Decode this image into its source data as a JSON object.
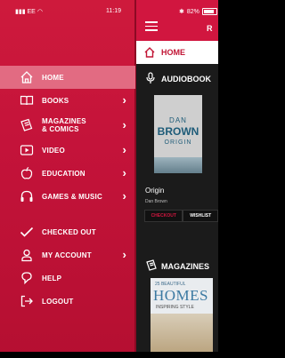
{
  "status_bar": {
    "carrier": "EE",
    "time": "11:19",
    "battery": "82%"
  },
  "menu": {
    "items": [
      {
        "label": "HOME",
        "icon": "home-icon"
      },
      {
        "label": "BOOKS",
        "icon": "book-icon"
      },
      {
        "label_line1": "MAGAZINES",
        "label_line2": "& COMICS",
        "icon": "magazine-icon"
      },
      {
        "label": "VIDEO",
        "icon": "video-icon"
      },
      {
        "label": "EDUCATION",
        "icon": "apple-icon"
      },
      {
        "label": "GAMES & MUSIC",
        "icon": "headphones-icon"
      },
      {
        "label": "CHECKED OUT",
        "icon": "checkmark-icon"
      },
      {
        "label": "MY ACCOUNT",
        "icon": "user-icon"
      },
      {
        "label": "HELP",
        "icon": "help-icon"
      },
      {
        "label": "LOGOUT",
        "icon": "logout-icon"
      }
    ]
  },
  "app": {
    "title": "R",
    "home_tab": "HOME",
    "audiobooks_title": "AUDIOBOOK",
    "book": {
      "cover_line1": "DAN",
      "cover_line2": "BROWN",
      "cover_line3": "ORIGIN",
      "title": "Origin",
      "author": "Dan Brown"
    },
    "checkout_label": "CHECKOUT",
    "wishlist_label": "WISHLIST",
    "magazines_title": "MAGAZINES",
    "magazine_cover": {
      "small": "25 BEAUTIFUL",
      "title": "HOMES",
      "subtitle": "INSPIRING STYLE"
    }
  },
  "colors": {
    "brand_red": "#d1163f",
    "active_item": "#e26b82"
  }
}
